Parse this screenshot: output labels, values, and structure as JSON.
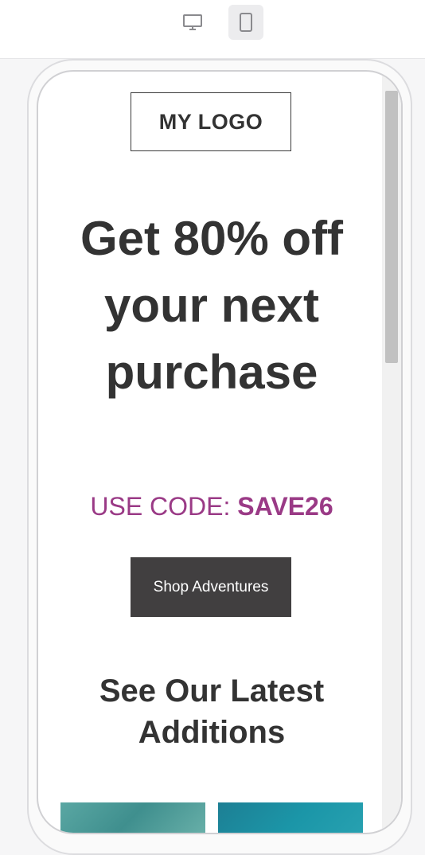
{
  "toolbar": {
    "desktop_icon": "desktop-icon",
    "mobile_icon": "mobile-icon",
    "active_view": "mobile"
  },
  "email": {
    "logo_text": "MY LOGO",
    "headline": "Get 80% off your next purchase",
    "promo_prefix": "USE CODE: ",
    "promo_code": "SAVE26",
    "cta_label": "Shop Adventures",
    "section_title": "See Our Latest Additions",
    "colors": {
      "text": "#333333",
      "accent": "#9a3a86",
      "button": "#413f40"
    }
  }
}
